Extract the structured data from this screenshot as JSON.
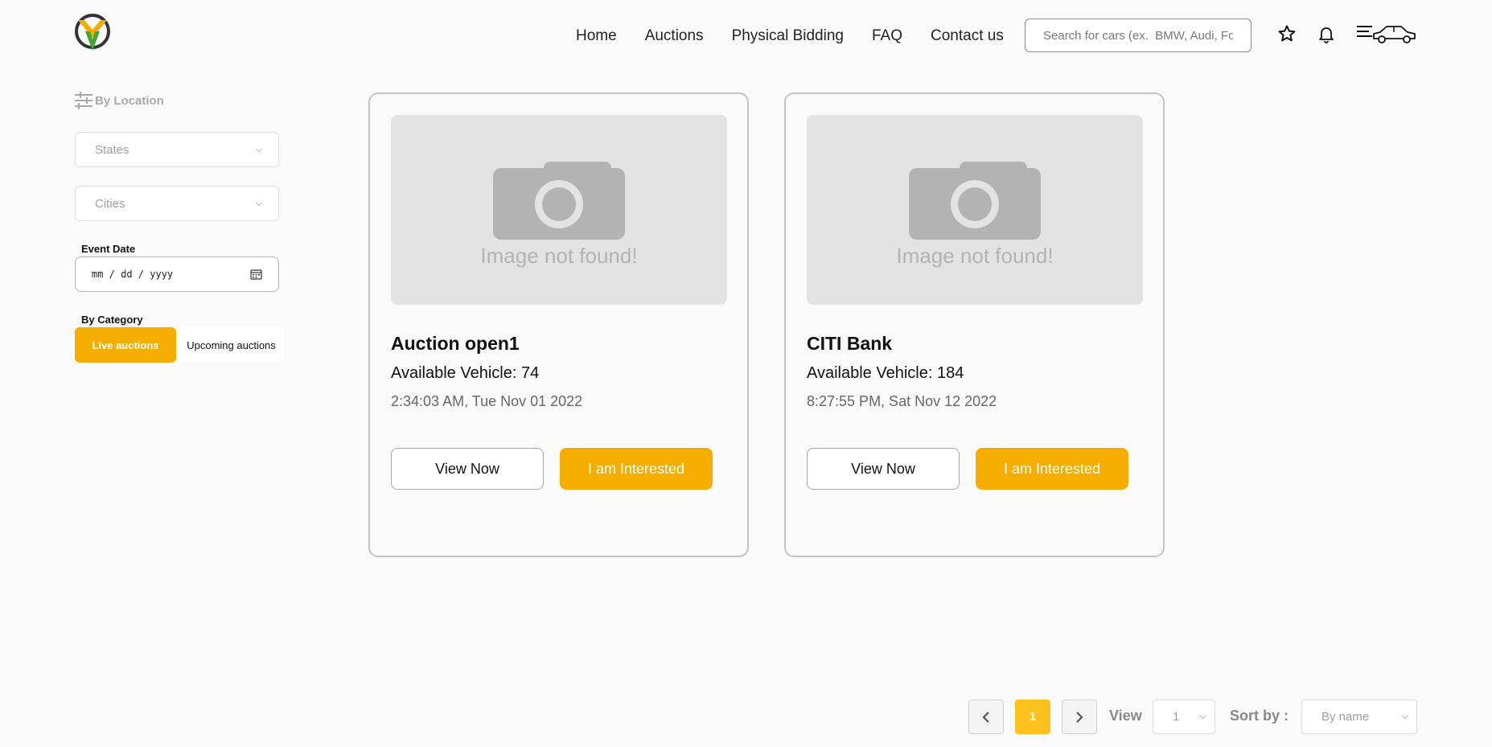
{
  "header": {
    "logo_icon": "vehicle-auction-logo-icon",
    "nav": [
      "Home",
      "Auctions",
      "Physical Bidding",
      "FAQ",
      "Contact us"
    ],
    "search_placeholder": "Search for cars (ex.  BMW, Audi, Ford)",
    "icons": [
      "star-icon",
      "bell-icon",
      "menu-car-icon"
    ]
  },
  "sidebar": {
    "heading": "By Location",
    "states_label": "States",
    "cities_label": "Cities",
    "event_date_label": "Event Date",
    "event_date_placeholder": "mm / dd / yyyy",
    "category_label": "By Category",
    "live_label": "Live auctions",
    "upcoming_label": "Upcoming auctions"
  },
  "cards": [
    {
      "image_text": "Image not found!",
      "title": "Auction open1",
      "available": "Available Vehicle: 74",
      "datetime": "2:34:03 AM, Tue Nov 01 2022",
      "view_label": "View Now",
      "interested_label": "I am Interested"
    },
    {
      "image_text": "Image not found!",
      "title": "CITI Bank",
      "available": "Available Vehicle: 184",
      "datetime": "8:27:55 PM, Sat Nov 12 2022",
      "view_label": "View Now",
      "interested_label": "I am Interested"
    }
  ],
  "pagination": {
    "current_page": "1",
    "view_label": "View",
    "view_value": "1",
    "sort_label": "Sort by :",
    "sort_value": "By name"
  },
  "colors": {
    "accent": "#f5ad00",
    "accent_page": "#fcc11c",
    "background": "#fafafa"
  }
}
